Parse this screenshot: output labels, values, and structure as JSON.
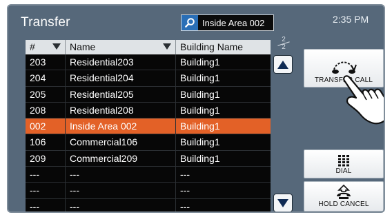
{
  "header": {
    "title": "Transfer",
    "search_value": "Inside Area 002",
    "time": "2:35 PM"
  },
  "table": {
    "columns": [
      "#",
      "Name",
      "Building Name"
    ],
    "rows": [
      {
        "num": "203",
        "name": "Residential203",
        "building": "Building1",
        "selected": false
      },
      {
        "num": "204",
        "name": "Residential204",
        "building": "Building1",
        "selected": false
      },
      {
        "num": "205",
        "name": "Residential205",
        "building": "Building1",
        "selected": false
      },
      {
        "num": "208",
        "name": "Residential208",
        "building": "Building1",
        "selected": false
      },
      {
        "num": "002",
        "name": "Inside Area 002",
        "building": "Building1",
        "selected": true
      },
      {
        "num": "106",
        "name": "Commercial106",
        "building": "Building1",
        "selected": false
      },
      {
        "num": "209",
        "name": "Commercial209",
        "building": "Building1",
        "selected": false
      },
      {
        "num": "---",
        "name": "---",
        "building": "---",
        "selected": false
      },
      {
        "num": "---",
        "name": "---",
        "building": "---",
        "selected": false
      },
      {
        "num": "---",
        "name": "---",
        "building": "---",
        "selected": false
      }
    ]
  },
  "pager": {
    "current": "2",
    "total": "2"
  },
  "buttons": {
    "transfer_call": "TRANSFER CALL",
    "dial": "DIAL",
    "hold_cancel": "HOLD CANCEL"
  },
  "colors": {
    "panel_bg": "#56687a",
    "selected_row": "#e36127",
    "search_icon_bg": "#2a6fb7",
    "scroll_arrow": "#0f2b54"
  }
}
